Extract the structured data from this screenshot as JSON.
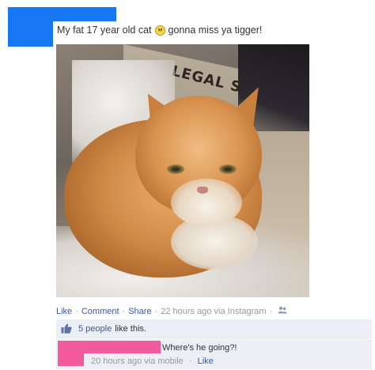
{
  "post": {
    "text_before_emoji": "My fat 17 year old cat",
    "emoji_icon": "frown-emoji-icon",
    "text_after_emoji": "gonna miss ya tigger!"
  },
  "photo": {
    "box_label": "LEGAL SI"
  },
  "actions": {
    "like": "Like",
    "comment": "Comment",
    "share": "Share",
    "separator": "·",
    "timestamp": "22 hours ago via Instagram",
    "audience_icon": "friends-icon"
  },
  "likes": {
    "count_text": "5 people",
    "suffix": "like this.",
    "icon": "thumbs-up-icon"
  },
  "comment": {
    "text": "Where's he going?!",
    "timestamp": "20 hours ago via mobile",
    "separator": "·",
    "like": "Like"
  },
  "colors": {
    "link": "#3b5998",
    "ufi_bg": "#eceff5",
    "redact_blue": "#1877f2",
    "redact_pink": "#f25a9c"
  }
}
